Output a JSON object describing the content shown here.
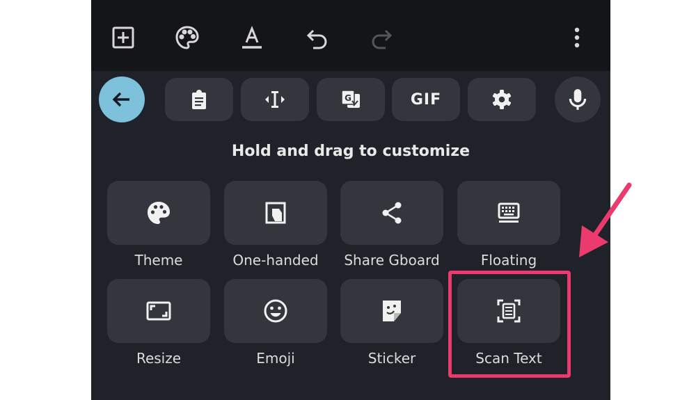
{
  "toolbar": {
    "icons": [
      "add-box-icon",
      "palette-icon",
      "text-format-icon",
      "undo-icon",
      "redo-icon",
      "more-vert-icon"
    ]
  },
  "keyboard_bar": {
    "items": [
      "clipboard-icon",
      "cursor-control-icon",
      "translate-icon",
      "gif",
      "settings-icon",
      "mic-icon"
    ],
    "gif_label": "GIF"
  },
  "hint": "Hold and drag to customize",
  "tiles": [
    {
      "label": "Theme",
      "icon": "palette-icon"
    },
    {
      "label": "One-handed",
      "icon": "one-handed-icon"
    },
    {
      "label": "Share Gboard",
      "icon": "share-icon"
    },
    {
      "label": "Floating",
      "icon": "floating-keyboard-icon"
    },
    {
      "label": "Resize",
      "icon": "resize-icon"
    },
    {
      "label": "Emoji",
      "icon": "emoji-icon"
    },
    {
      "label": "Sticker",
      "icon": "sticker-icon"
    },
    {
      "label": "Scan Text",
      "icon": "scan-text-icon"
    }
  ],
  "colors": {
    "panel": "#1f2229",
    "toolbar": "#141518",
    "tile": "#33363d",
    "back_button": "#7ec1da",
    "highlight": "#ea3a6e"
  }
}
